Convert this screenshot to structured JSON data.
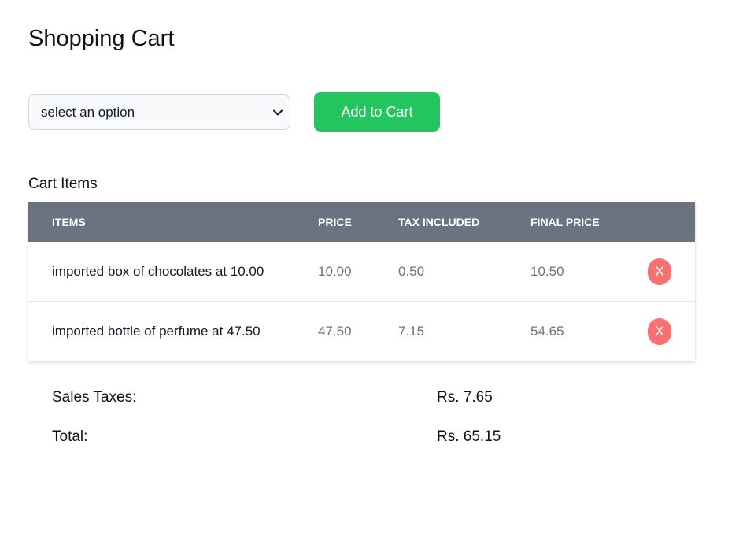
{
  "page": {
    "title": "Shopping Cart"
  },
  "controls": {
    "select_value": "select an option",
    "select_icon": "chevron-down-icon",
    "add_button_label": "Add to Cart"
  },
  "cart": {
    "section_label": "Cart Items",
    "columns": [
      "ITEMS",
      "PRICE",
      "TAX INCLUDED",
      "FINAL PRICE"
    ],
    "rows": [
      {
        "item": "imported box of chocolates at 10.00",
        "price": "10.00",
        "tax": "0.50",
        "final": "10.50",
        "remove_label": "X"
      },
      {
        "item": "imported bottle of perfume at 47.50",
        "price": "47.50",
        "tax": "7.15",
        "final": "54.65",
        "remove_label": "X"
      }
    ]
  },
  "summary": {
    "sales_taxes_label": "Sales Taxes:",
    "sales_taxes_value": "Rs. 7.65",
    "total_label": "Total:",
    "total_value": "Rs. 65.15"
  },
  "colors": {
    "add_button": "#22c55e",
    "table_header": "#6b7280",
    "remove_button": "#f87171"
  }
}
